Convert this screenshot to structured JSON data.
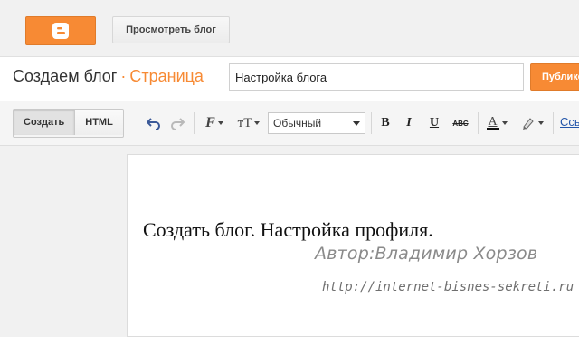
{
  "header": {
    "view_blog_label": "Просмотреть блог"
  },
  "titlebar": {
    "blog_name": "Создаем блог",
    "separator": "·",
    "section": "Страница",
    "post_title_value": "Настройка блога",
    "publish_label": "Публиковать"
  },
  "toolbar": {
    "mode_compose": "Создать",
    "mode_html": "HTML",
    "font_icon_label": "F",
    "font_size_icon_label": "тT",
    "format_value": "Обычный",
    "bold": "B",
    "italic": "I",
    "underline": "U",
    "strike": "ABC",
    "text_color": "A",
    "link_label": "Ссылка"
  },
  "editor": {
    "body_text": "Создать блог. Настройка профиля.",
    "watermark_author": "Автор:Владимир Хорзов",
    "watermark_site": "http://internet-bisnes-sekreti.ru"
  },
  "colors": {
    "accent": "#f78a34",
    "link": "#2255aa"
  }
}
